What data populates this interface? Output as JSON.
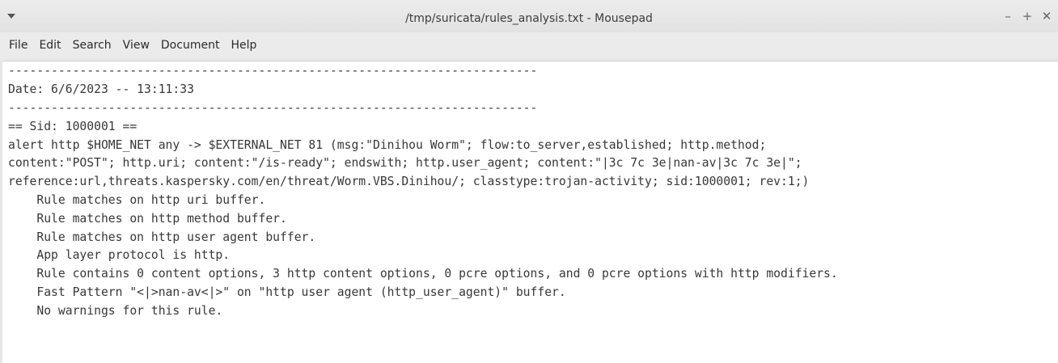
{
  "window": {
    "title": "/tmp/suricata/rules_analysis.txt - Mousepad",
    "controls": {
      "minimize": "–",
      "maximize": "+",
      "close": "✕"
    }
  },
  "menubar": {
    "items": [
      "File",
      "Edit",
      "Search",
      "View",
      "Document",
      "Help"
    ]
  },
  "editor": {
    "lines": [
      "--------------------------------------------------------------------------",
      "Date: 6/6/2023 -- 13:11:33",
      "--------------------------------------------------------------------------",
      "== Sid: 1000001 ==",
      "alert http $HOME_NET any -> $EXTERNAL_NET 81 (msg:\"Dinihou Worm\"; flow:to_server,established; http.method;",
      "content:\"POST\"; http.uri; content:\"/is-ready\"; endswith; http.user_agent; content:\"|3c 7c 3e|nan-av|3c 7c 3e|\";",
      "reference:url,threats.kaspersky.com/en/threat/Worm.VBS.Dinihou/; classtype:trojan-activity; sid:1000001; rev:1;)",
      "    Rule matches on http uri buffer.",
      "    Rule matches on http method buffer.",
      "    Rule matches on http user agent buffer.",
      "    App layer protocol is http.",
      "    Rule contains 0 content options, 3 http content options, 0 pcre options, and 0 pcre options with http modifiers.",
      "    Fast Pattern \"<|>nan-av<|>\" on \"http user agent (http_user_agent)\" buffer.",
      "    No warnings for this rule."
    ]
  }
}
